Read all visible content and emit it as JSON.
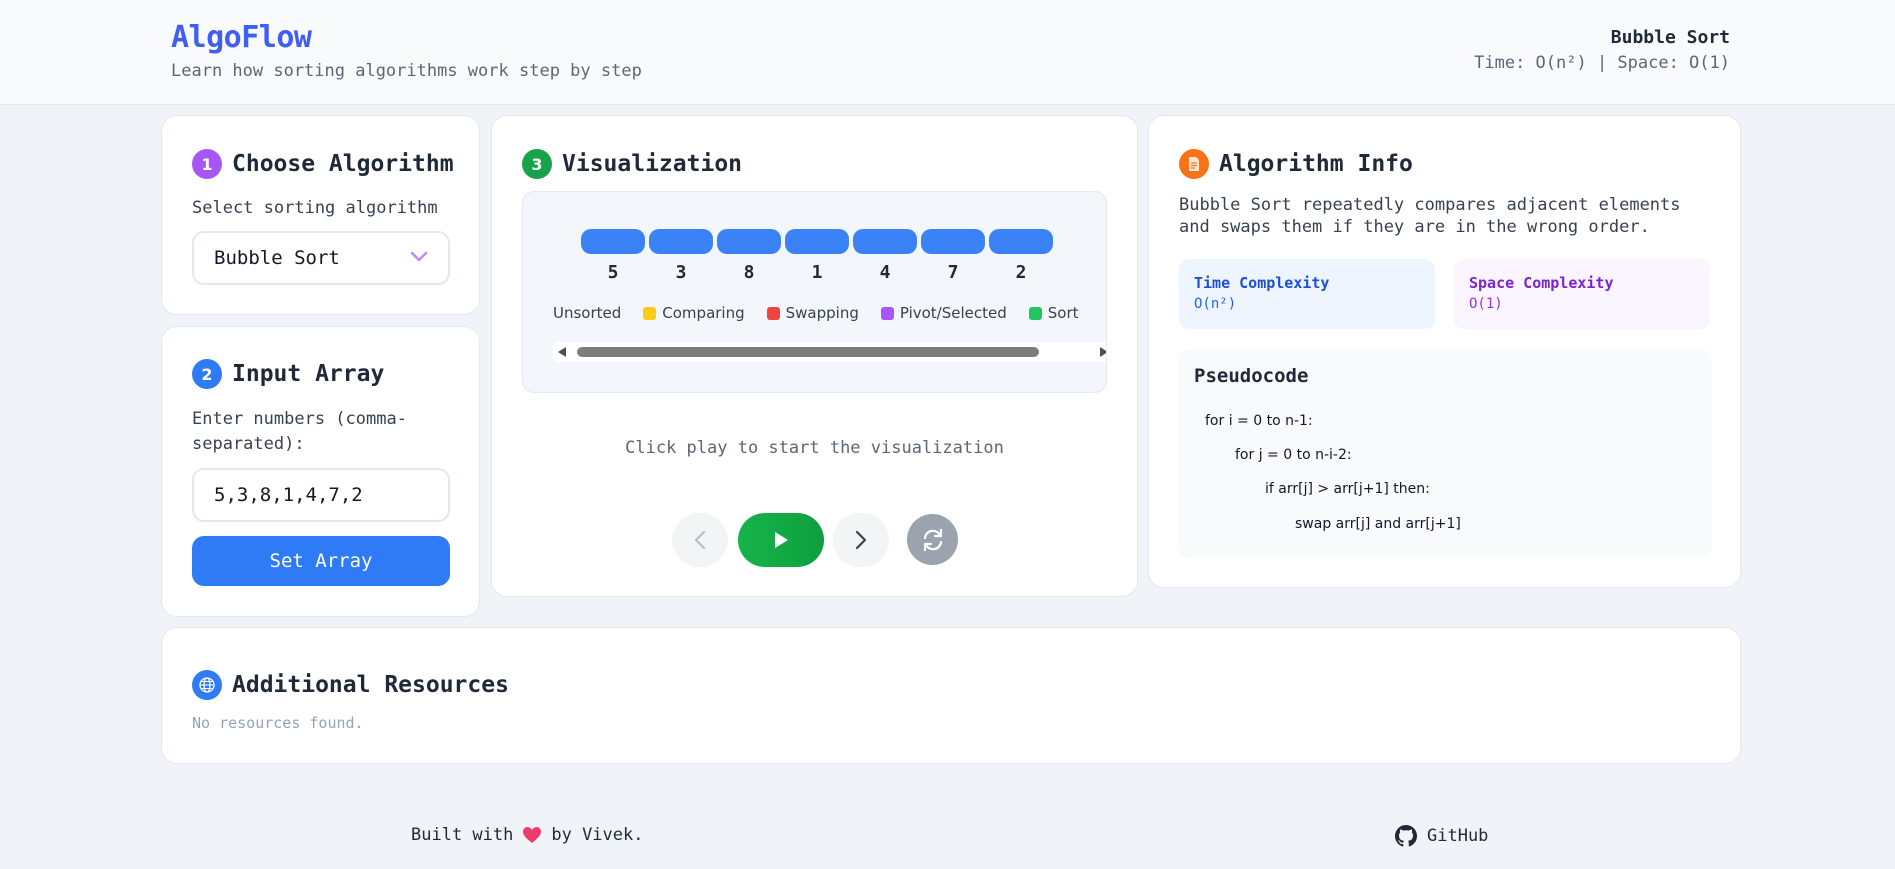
{
  "header": {
    "logo": "AlgoFlow",
    "tagline": "Learn how sorting algorithms work step by step",
    "algo_name": "Bubble Sort",
    "complexity": "Time: O(n²) | Space: O(1)"
  },
  "choose": {
    "step": "1",
    "title": "Choose Algorithm",
    "label": "Select sorting algorithm",
    "selected": "Bubble Sort"
  },
  "input": {
    "step": "2",
    "title": "Input Array",
    "label": "Enter numbers (comma-separated):",
    "value": "5,3,8,1,4,7,2",
    "button": "Set Array"
  },
  "viz": {
    "step": "3",
    "title": "Visualization",
    "bars": [
      "5",
      "3",
      "8",
      "1",
      "4",
      "7",
      "2"
    ],
    "legend": [
      "Unsorted",
      "Comparing",
      "Swapping",
      "Pivot/Selected",
      "Sort"
    ],
    "hint": "Click play to start the visualization",
    "controls": [
      "prev-icon",
      "play-icon",
      "next-icon",
      "reset-icon"
    ]
  },
  "info": {
    "title": "Algorithm Info",
    "description": "Bubble Sort repeatedly compares adjacent elements and swaps them if they are in the wrong order.",
    "time_label": "Time Complexity",
    "time_value": "O(n²)",
    "space_label": "Space Complexity",
    "space_value": "O(1)",
    "pseudo_title": "Pseudocode",
    "pseudo": [
      "for i = 0 to n-1:",
      "for j = 0 to n-i-2:",
      "if arr[j] > arr[j+1] then:",
      "swap arr[j] and arr[j+1]"
    ]
  },
  "resources": {
    "title": "Additional Resources",
    "empty": "No resources found."
  },
  "footer": {
    "built_prefix": "Built with",
    "built_suffix": "by Vivek.",
    "github": "GitHub"
  },
  "colors": {
    "brand": "#3f5ef5",
    "primary": "#2f7bf6",
    "play": "#16a34a",
    "unsorted": "#3b82f6",
    "comparing": "#facc15",
    "swapping": "#ef4444",
    "pivot": "#a855f7",
    "sorted": "#22c55e"
  }
}
